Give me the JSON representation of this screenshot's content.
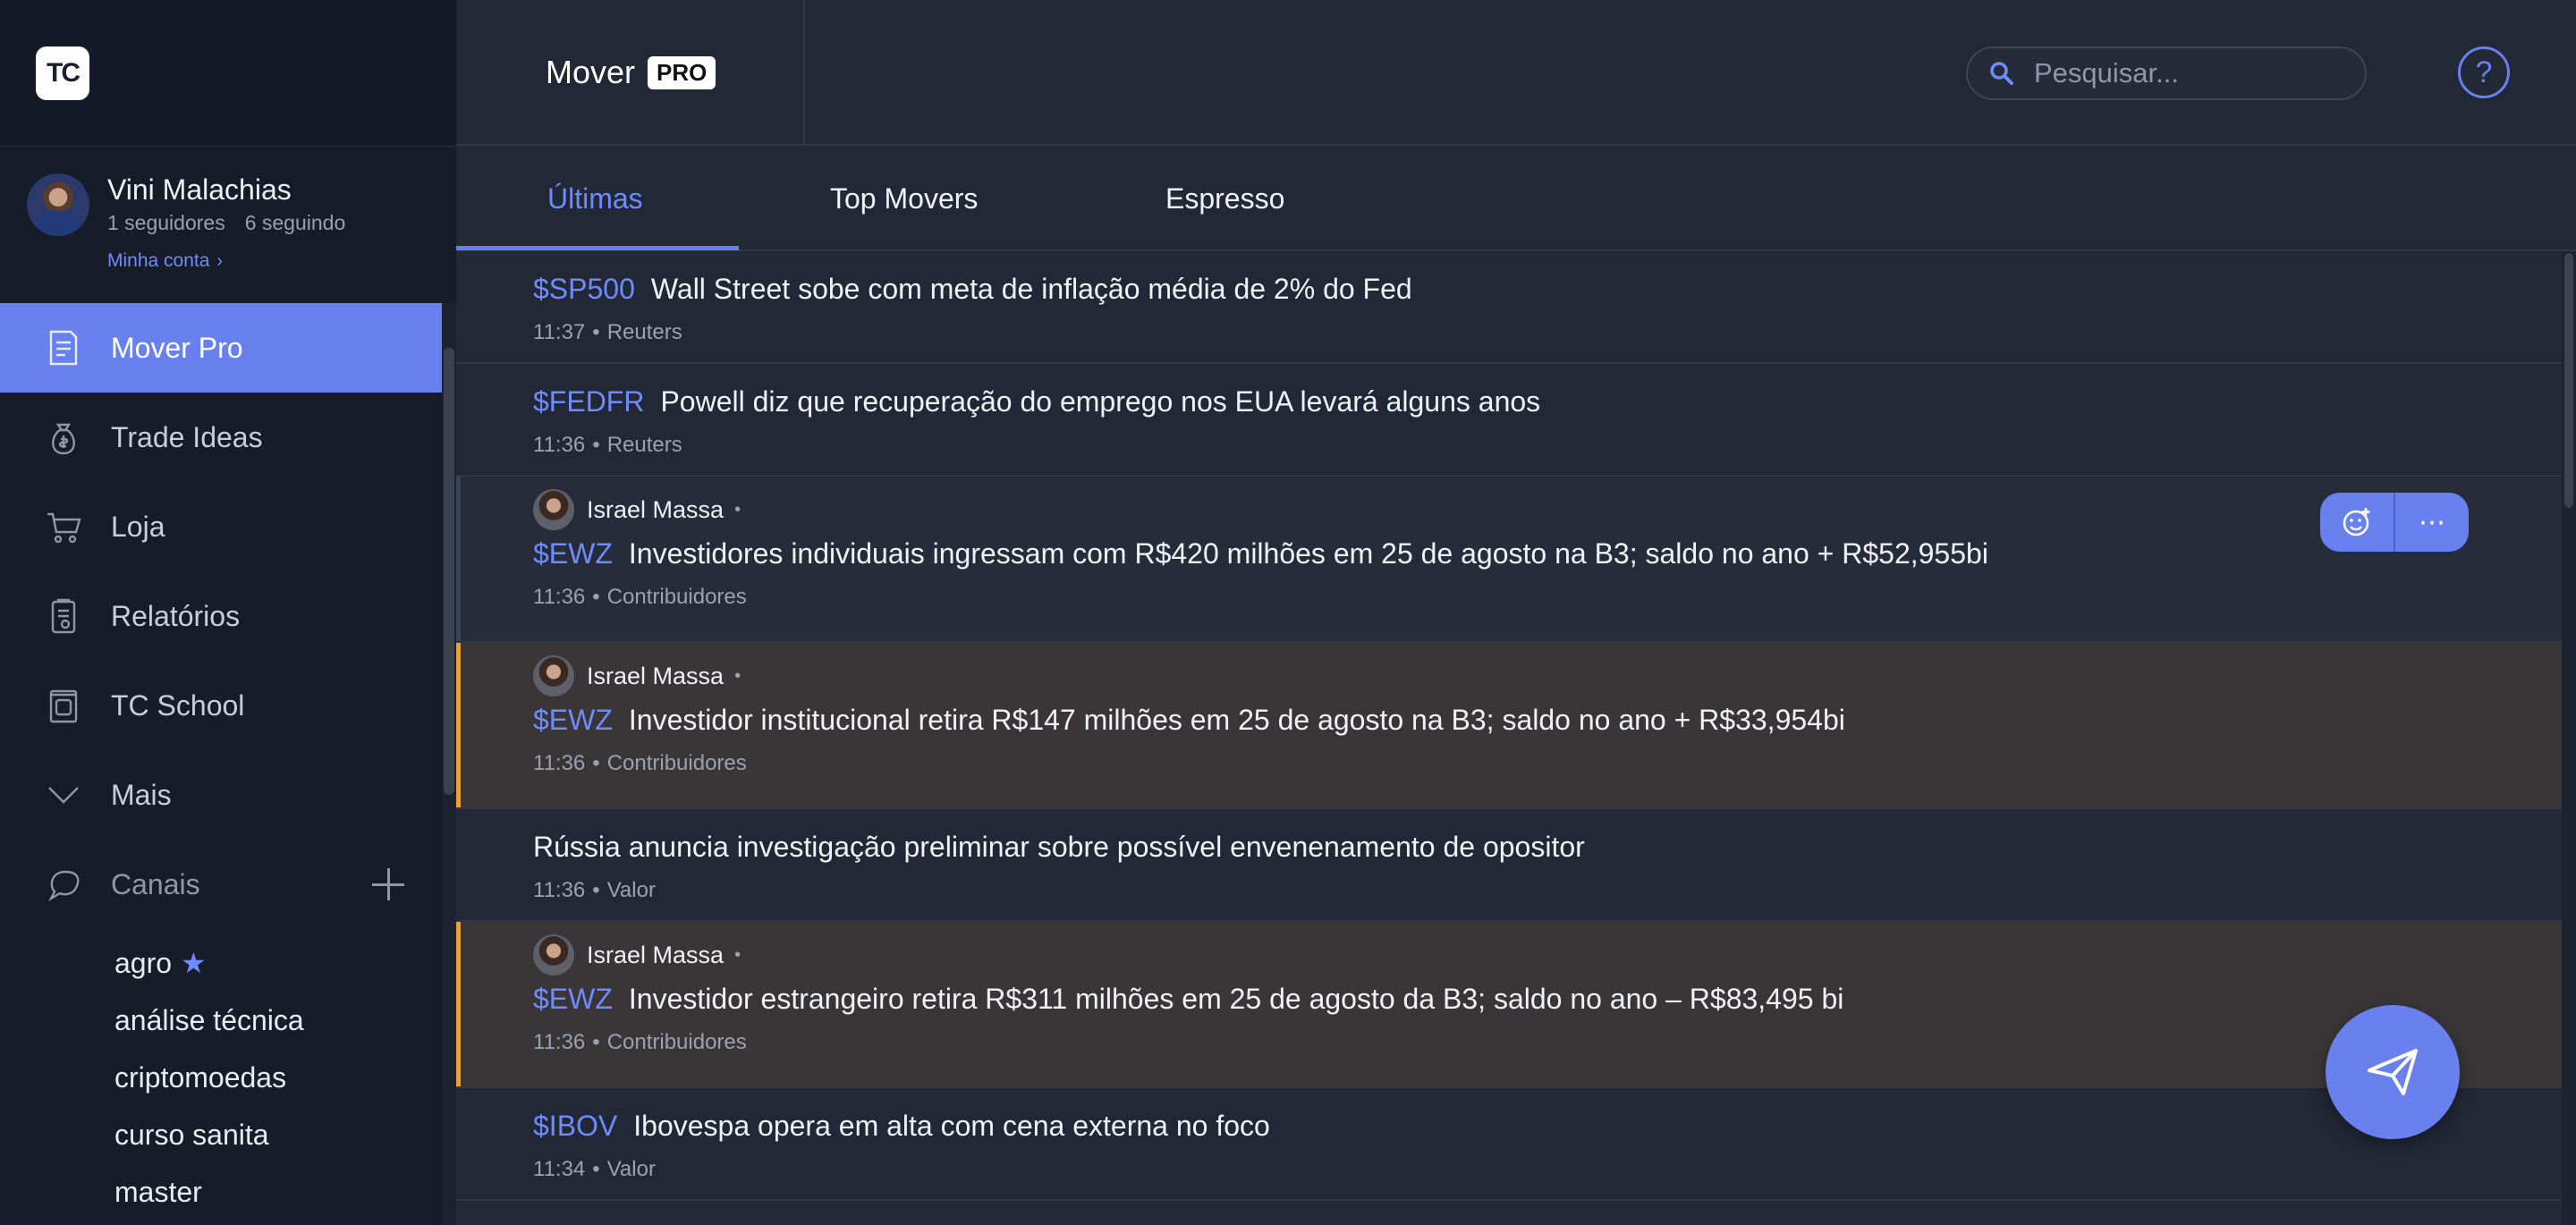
{
  "app": {
    "logo_text": "TC",
    "title": "Mover",
    "badge": "PRO"
  },
  "profile": {
    "name": "Vini Malachias",
    "followers": "1 seguidores",
    "following": "6 seguindo",
    "account_link": "Minha conta",
    "account_chevron": "›"
  },
  "nav": {
    "items": [
      {
        "label": "Mover Pro",
        "icon": "news-icon",
        "active": true
      },
      {
        "label": "Trade Ideas",
        "icon": "money-bag-icon"
      },
      {
        "label": "Loja",
        "icon": "cart-icon"
      },
      {
        "label": "Relatórios",
        "icon": "report-icon"
      },
      {
        "label": "TC School",
        "icon": "school-icon"
      },
      {
        "label": "Mais",
        "icon": "chevron-down-icon"
      }
    ],
    "channels_label": "Canais",
    "channels": [
      {
        "label": "agro",
        "starred": "★"
      },
      {
        "label": "análise técnica"
      },
      {
        "label": "criptomoedas"
      },
      {
        "label": "curso sanita"
      },
      {
        "label": "master"
      }
    ]
  },
  "header": {
    "search_placeholder": "Pesquisar...",
    "help_label": "?"
  },
  "tabs": [
    {
      "label": "Últimas",
      "active": true
    },
    {
      "label": "Top Movers"
    },
    {
      "label": "Espresso"
    }
  ],
  "feed": [
    {
      "ticker": "$SP500",
      "text": "Wall Street sobe com meta de inflação média de 2% do Fed",
      "time": "11:37",
      "source": "Reuters"
    },
    {
      "ticker": "$FEDFR",
      "text": "Powell diz que recuperação do emprego nos EUA levará alguns anos",
      "time": "11:36",
      "source": "Reuters"
    },
    {
      "author": "Israel Massa",
      "ticker": "$EWZ",
      "text": "Investidores individuais ingressam com R$420 milhões em 25 de agosto na B3; saldo no ano + R$52,955bi",
      "time": "11:36",
      "source": "Contribuidores"
    },
    {
      "author": "Israel Massa",
      "ticker": "$EWZ",
      "text": "Investidor institucional retira R$147 milhões em 25 de agosto na B3; saldo no ano + R$33,954bi",
      "time": "11:36",
      "source": "Contribuidores"
    },
    {
      "text": "Rússia anuncia investigação preliminar sobre possível envenenamento de opositor",
      "time": "11:36",
      "source": "Valor"
    },
    {
      "author": "Israel Massa",
      "ticker": "$EWZ",
      "text": "Investidor estrangeiro retira R$311 milhões em 25 de agosto da B3; saldo no ano – R$83,495 bi",
      "time": "11:36",
      "source": "Contribuidores"
    },
    {
      "ticker": "$IBOV",
      "text": "Ibovespa opera em alta com cena externa no foco",
      "time": "11:34",
      "source": "Valor"
    }
  ],
  "item_actions": {
    "react": "add-reaction-icon",
    "more": "⋯"
  },
  "colors": {
    "accent": "#6980ef",
    "highlight_bar": "#e8a13f",
    "background": "#222836",
    "sidebar": "#161c28"
  }
}
